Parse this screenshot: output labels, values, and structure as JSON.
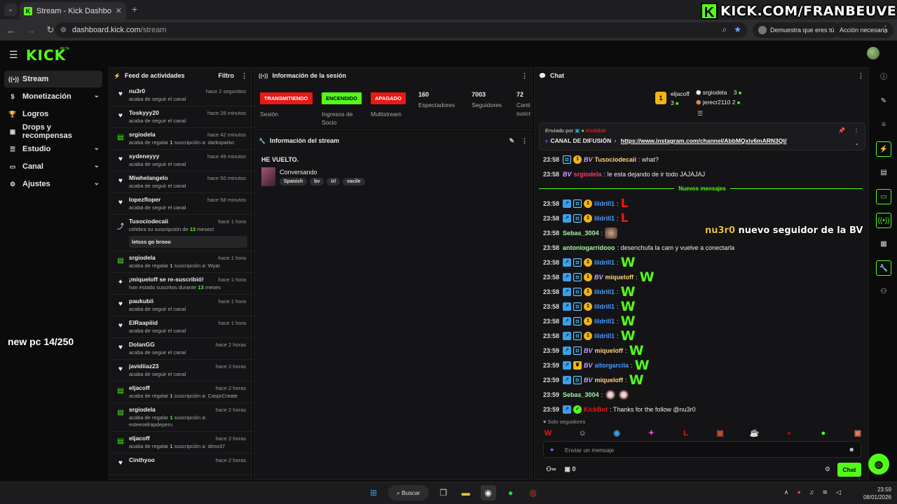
{
  "browser": {
    "tab_title": "Stream - Kick Dashboard",
    "url_host": "dashboard.kick.com",
    "url_path": "/stream",
    "profile_pill": "Demuestra que eres tú",
    "action_pill": "Acción necesaria"
  },
  "watermark": {
    "text": "KICK.COM/FRANBEUVE"
  },
  "header": {
    "logo": "KICK",
    "beta": "BETA"
  },
  "leftnav": {
    "items": [
      {
        "label": "Stream",
        "icon": "signal-icon",
        "active": true,
        "chevron": false
      },
      {
        "label": "Monetización",
        "icon": "dollar-icon",
        "active": false,
        "chevron": true
      },
      {
        "label": "Logros",
        "icon": "trophy-icon",
        "active": false,
        "chevron": false
      },
      {
        "label": "Drops y recompensas",
        "icon": "gift-icon",
        "active": false,
        "chevron": false
      },
      {
        "label": "Estudio",
        "icon": "sliders-icon",
        "active": false,
        "chevron": true
      },
      {
        "label": "Canal",
        "icon": "tv-icon",
        "active": false,
        "chevron": true
      },
      {
        "label": "Ajustes",
        "icon": "gear-icon",
        "active": false,
        "chevron": true
      }
    ],
    "overlay_text": "new pc 14/250"
  },
  "feed": {
    "title": "Feed de actividades",
    "filter": "Filtro",
    "items": [
      {
        "icon": "heart",
        "name": "nu3r0",
        "time": "hace 2 segundos",
        "sub_pre": "acaba de seguir el canal",
        "sub_hl": "",
        "sub_post": "",
        "msg": ""
      },
      {
        "icon": "heart",
        "name": "Toskyyy20",
        "time": "hace 28 minutos",
        "sub_pre": "acaba de seguir el canal",
        "sub_hl": "",
        "sub_post": "",
        "msg": ""
      },
      {
        "icon": "gift",
        "name": "srgiodela",
        "time": "hace 42 minutos",
        "sub_pre": "acaba de regalar ",
        "sub_hl": "1",
        "sub_post": " suscripción a: darkoparko",
        "msg": ""
      },
      {
        "icon": "heart",
        "name": "sydeneyyy",
        "time": "hace 49 minutos",
        "sub_pre": "acaba de seguir el canal",
        "sub_hl": "",
        "sub_post": "",
        "msg": ""
      },
      {
        "icon": "heart",
        "name": "Miwhelangelo",
        "time": "hace 50 minutos",
        "sub_pre": "acaba de seguir el canal",
        "sub_hl": "",
        "sub_post": "",
        "msg": ""
      },
      {
        "icon": "heart",
        "name": "lopezfloper",
        "time": "hace 58 minutos",
        "sub_pre": "acaba de seguir el canal",
        "sub_hl": "",
        "sub_post": "",
        "msg": ""
      },
      {
        "icon": "star",
        "name": "Tusociodecaii",
        "time": "hace 1 hora",
        "sub_pre": "celebra su suscripción de ",
        "sub_hl": "13",
        "sub_post": " meses!",
        "msg": "letsss go brooo"
      },
      {
        "icon": "gift",
        "name": "srgiodela",
        "time": "hace 1 hora",
        "sub_pre": "acaba de regalar ",
        "sub_hl": "1",
        "sub_post": " suscripción a: Wyar",
        "msg": ""
      },
      {
        "icon": "sparkle",
        "name": "¡miqueloff se re-suscribió!",
        "time": "hace 1 hora",
        "sub_pre": "han estado suscritos durante ",
        "sub_hl": "13",
        "sub_post": " meses",
        "msg": ""
      },
      {
        "icon": "heart",
        "name": "paukubii",
        "time": "hace 1 hora",
        "sub_pre": "acaba de seguir el canal",
        "sub_hl": "",
        "sub_post": "",
        "msg": ""
      },
      {
        "icon": "heart",
        "name": "ElRaapiiid",
        "time": "hace 1 hora",
        "sub_pre": "acaba de seguir el canal",
        "sub_hl": "",
        "sub_post": "",
        "msg": ""
      },
      {
        "icon": "heart",
        "name": "DolanGG",
        "time": "hace 2 horas",
        "sub_pre": "acaba de seguir el canal",
        "sub_hl": "",
        "sub_post": "",
        "msg": ""
      },
      {
        "icon": "heart",
        "name": "javidiiaz23",
        "time": "hace 2 horas",
        "sub_pre": "acaba de seguir el canal",
        "sub_hl": "",
        "sub_post": "",
        "msg": ""
      },
      {
        "icon": "gift",
        "name": "eljacoff",
        "time": "hace 2 horas",
        "sub_pre": "acaba de regalar ",
        "sub_hl": "1",
        "sub_post": " suscripción a: CasprCreate",
        "msg": ""
      },
      {
        "icon": "gift",
        "name": "srgiodela",
        "time": "hace 2 horas",
        "sub_pre": "acaba de regalar ",
        "sub_hl": "1",
        "sub_post": " suscripción a: esteeselrapdeperu",
        "msg": ""
      },
      {
        "icon": "gift",
        "name": "eljacoff",
        "time": "hace 2 horas",
        "sub_pre": "acaba de regalar ",
        "sub_hl": "1",
        "sub_post": " suscripción a: dimo37",
        "msg": ""
      },
      {
        "icon": "heart",
        "name": "Cinthyoo",
        "time": "hace 2 horas",
        "sub_pre": "",
        "sub_hl": "",
        "sub_post": "",
        "msg": ""
      }
    ]
  },
  "session": {
    "title": "Información de la sesión",
    "stats": [
      {
        "badge": "TRANSMITIENDO",
        "badge_color": "red",
        "label": "Sesión"
      },
      {
        "badge": "ENCENDIDO",
        "badge_color": "green",
        "label": "Ingresos de Socio"
      },
      {
        "badge": "APAGADO",
        "badge_color": "red",
        "label": "Multistream"
      },
      {
        "number": "160",
        "label": "Espectadores"
      },
      {
        "number": "7003",
        "label": "Seguidores"
      },
      {
        "number": "72",
        "label": "Canti suscr"
      }
    ]
  },
  "stream_info": {
    "title": "Información del stream",
    "stream_title": "HE VUELTO.",
    "category": "Conversando",
    "tags": [
      "Spanish",
      "bv",
      "irl",
      "vacile"
    ]
  },
  "chat": {
    "title": "Chat",
    "leaderboard": {
      "first_name": "eljacoff",
      "first_count": "3",
      "first_rank": "1",
      "second_name": "srgiodela",
      "second_count": "3",
      "third_name": "jerecr2110",
      "third_count": "2"
    },
    "pinned": {
      "sent_by": "Enviado por",
      "bot": "KickBot",
      "label": "CANAL DE DIFUSIÓN",
      "link": "https://www.instagram.com/channel/AbbMQxiv6mARN3Qt/"
    },
    "new_messages_label": "Nuevos mensajes",
    "messages": [
      {
        "time": "23:58",
        "user": "Tusociodecaii",
        "color": "u-gold",
        "badges": [
          "sub",
          "gold",
          "bv"
        ],
        "text": ": what?",
        "emote": ""
      },
      {
        "time": "23:58",
        "user": "srgiodela",
        "color": "u-pink",
        "badges": [
          "bv"
        ],
        "text": ": le esta dejando de ir todo JAJAJAJ",
        "emote": ""
      },
      {
        "divider": true
      },
      {
        "time": "23:58",
        "user": "lildrill1",
        "color": "u-blue",
        "badges": [
          "blue",
          "sub",
          "gold"
        ],
        "text": ":",
        "emote": "L"
      },
      {
        "time": "23:58",
        "user": "lildrill1",
        "color": "u-blue",
        "badges": [
          "blue",
          "sub",
          "gold"
        ],
        "text": ":",
        "emote": "L"
      },
      {
        "time": "23:58",
        "user": "Sebas_3004",
        "color": "u-green",
        "badges": [],
        "text": ":",
        "emote": "face"
      },
      {
        "time": "23:58",
        "user": "antoniogarridooo",
        "color": "u-green",
        "badges": [],
        "text": ": desenchufa la cam y vuelve a conectarla",
        "emote": ""
      },
      {
        "time": "23:58",
        "user": "lildrill1",
        "color": "u-blue",
        "badges": [
          "blue",
          "sub",
          "gold"
        ],
        "text": ":",
        "emote": "W"
      },
      {
        "time": "23:58",
        "user": "miqueloff",
        "color": "u-gold",
        "badges": [
          "blue",
          "sub",
          "gold",
          "bv"
        ],
        "text": ":",
        "emote": "W"
      },
      {
        "time": "23:58",
        "user": "lildrill1",
        "color": "u-blue",
        "badges": [
          "blue",
          "sub",
          "gold"
        ],
        "text": ":",
        "emote": "W"
      },
      {
        "time": "23:58",
        "user": "lildrill1",
        "color": "u-blue",
        "badges": [
          "blue",
          "sub",
          "gold"
        ],
        "text": ":",
        "emote": "W"
      },
      {
        "time": "23:58",
        "user": "lildrill1",
        "color": "u-blue",
        "badges": [
          "blue",
          "sub",
          "gold"
        ],
        "text": ":",
        "emote": "W"
      },
      {
        "time": "23:58",
        "user": "lildrill1",
        "color": "u-blue",
        "badges": [
          "blue",
          "sub",
          "gold"
        ],
        "text": ":",
        "emote": "W"
      },
      {
        "time": "23:59",
        "user": "miqueloff",
        "color": "u-gold",
        "badges": [
          "blue",
          "sub",
          "bv"
        ],
        "text": ":",
        "emote": "W"
      },
      {
        "time": "23:59",
        "user": "aitorgarciia",
        "color": "u-blue",
        "badges": [
          "blue",
          "crown",
          "bv"
        ],
        "text": ":",
        "emote": "W"
      },
      {
        "time": "23:59",
        "user": "miqueloff",
        "color": "u-gold",
        "badges": [
          "blue",
          "sub",
          "bv"
        ],
        "text": ":",
        "emote": "W"
      },
      {
        "time": "23:59",
        "user": "Sebas_3004",
        "color": "u-green",
        "badges": [],
        "text": ":",
        "emote": "face2"
      },
      {
        "time": "23:59",
        "user": "KickBot",
        "color": "u-red",
        "badges": [
          "blue",
          "gift"
        ],
        "text": ": Thanks for the follow @nu3r0",
        "emote": ""
      }
    ],
    "follower_overlay": {
      "name": "nu3r0",
      "text": "nuevo seguidor de la BV"
    },
    "solo": "Solo seguidores",
    "input_placeholder": "Enviar un mensaje",
    "footer_count": "0",
    "send_label": "Chat"
  },
  "taskbar": {
    "search": "Buscar",
    "time": "23:59",
    "date": "08/01/2026"
  },
  "colors": {
    "accent": "#53fc18",
    "red": "#e91916",
    "bg": "#0b0b0c",
    "panel": "#141416"
  }
}
